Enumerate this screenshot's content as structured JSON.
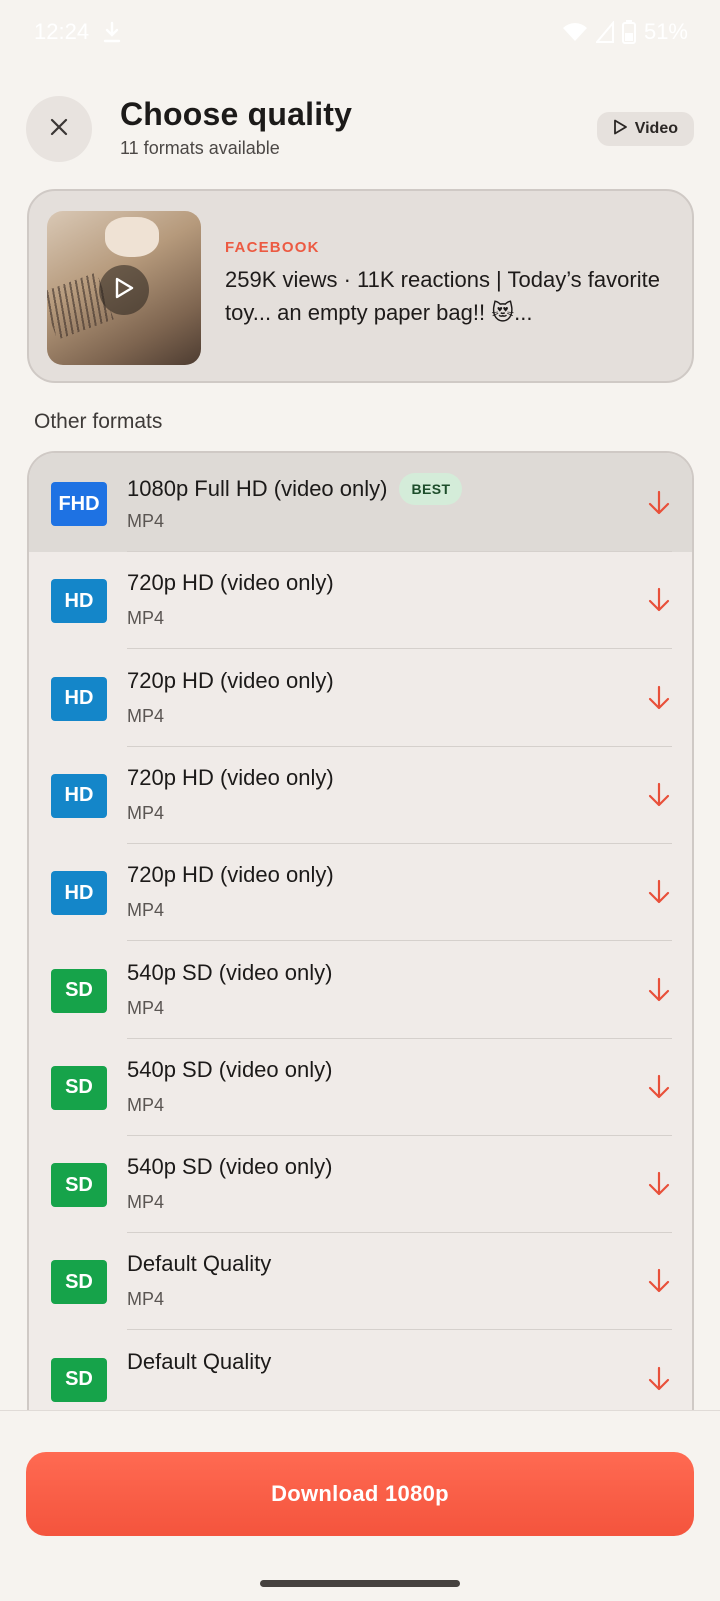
{
  "status_bar": {
    "time": "12:24",
    "battery": "51%"
  },
  "header": {
    "title": "Choose quality",
    "subtitle": "11 formats available",
    "video_chip_label": "Video"
  },
  "media": {
    "source": "FACEBOOK",
    "title": "259K views · 11K reactions | Today’s favorite toy... an empty paper bag!! 😻..."
  },
  "section_label": "Other formats",
  "formats": [
    {
      "badge": "FHD",
      "badge_color": "#1e72e3",
      "title": "1080p Full HD (video only)",
      "format": "MP4",
      "best_label": "BEST",
      "selected": true
    },
    {
      "badge": "HD",
      "badge_color": "#1486c9",
      "title": "720p HD (video only)",
      "format": "MP4"
    },
    {
      "badge": "HD",
      "badge_color": "#1486c9",
      "title": "720p HD (video only)",
      "format": "MP4"
    },
    {
      "badge": "HD",
      "badge_color": "#1486c9",
      "title": "720p HD (video only)",
      "format": "MP4"
    },
    {
      "badge": "HD",
      "badge_color": "#1486c9",
      "title": "720p HD (video only)",
      "format": "MP4"
    },
    {
      "badge": "SD",
      "badge_color": "#16a34a",
      "title": "540p SD (video only)",
      "format": "MP4"
    },
    {
      "badge": "SD",
      "badge_color": "#16a34a",
      "title": "540p SD (video only)",
      "format": "MP4"
    },
    {
      "badge": "SD",
      "badge_color": "#16a34a",
      "title": "540p SD (video only)",
      "format": "MP4"
    },
    {
      "badge": "SD",
      "badge_color": "#16a34a",
      "title": "Default Quality",
      "format": "MP4"
    },
    {
      "badge": "SD",
      "badge_color": "#16a34a",
      "title": "Default Quality",
      "format": ""
    }
  ],
  "download_button_label": "Download 1080p",
  "colors": {
    "accent": "#f4543d",
    "download_arrow": "#e8503a"
  }
}
